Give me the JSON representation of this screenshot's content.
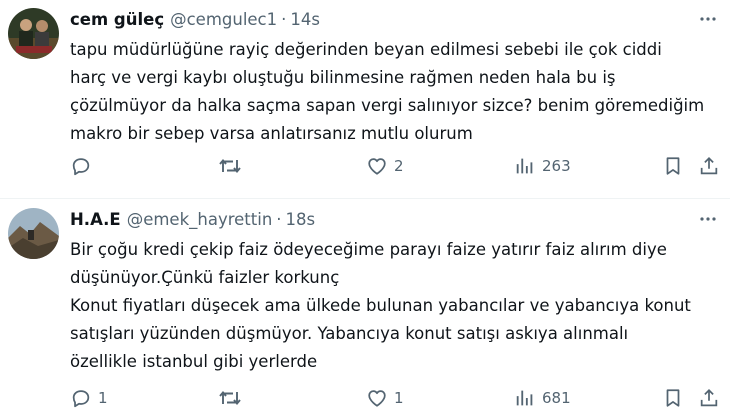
{
  "tweets": [
    {
      "name": "cem güleç",
      "handle": "@cemgulec1",
      "separator": "·",
      "time": "14s",
      "lines": [
        "tapu müdürlüğüne rayiç değerinden beyan edilmesi sebebi ile çok ciddi",
        "harç ve vergi kaybı oluştuğu bilinmesine rağmen neden hala bu iş",
        "çözülmüyor da halka saçma sapan vergi salınıyor sizce? benim göremediğim",
        "makro bir sebep varsa anlatırsanız mutlu olurum"
      ],
      "replies": "",
      "retweets": "",
      "likes": "2",
      "views": "263"
    },
    {
      "name": "H.A.E",
      "handle": "@emek_hayrettin",
      "separator": "·",
      "time": "18s",
      "lines": [
        "Bir çoğu kredi çekip faiz ödeyeceğime parayı faize yatırır faiz alırım diye",
        "düşünüyor.Çünkü faizler korkunç",
        "Konut fiyatları düşecek ama ülkede bulunan yabancılar ve yabancıya konut",
        "satışları yüzünden düşmüyor. Yabancıya konut satışı askıya alınmalı",
        "özellikle istanbul gibi yerlerde"
      ],
      "replies": "1",
      "retweets": "",
      "likes": "1",
      "views": "681"
    }
  ],
  "icons": {
    "reply": "reply-icon",
    "retweet": "retweet-icon",
    "like": "heart-icon",
    "views": "views-icon",
    "bookmark": "bookmark-icon",
    "share": "share-icon",
    "more": "more-icon"
  },
  "colors": {
    "text": "#0f1419",
    "secondary": "#536471",
    "divider": "#eff3f4"
  }
}
